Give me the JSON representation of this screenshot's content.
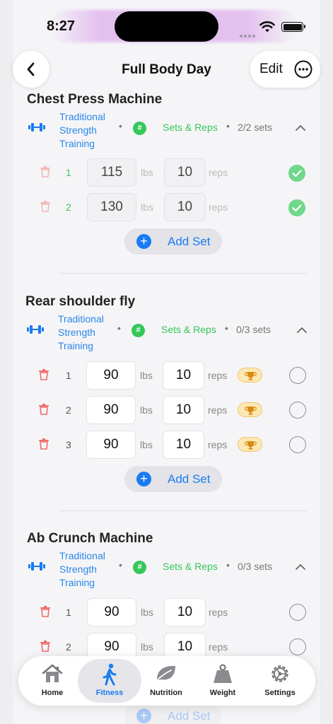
{
  "status": {
    "time": "8:27"
  },
  "header": {
    "title": "Full Body Day",
    "edit_label": "Edit"
  },
  "exercises": [
    {
      "name": "Chest Press Machine",
      "type": "Traditional Strength Training",
      "type_lines": [
        "Traditional",
        "Strength",
        "Training"
      ],
      "mode": "Sets & Reps",
      "count": "2/2 sets",
      "sets": [
        {
          "num": "1",
          "weight": "115",
          "unit": "lbs",
          "reps": "10",
          "reps_unit": "reps",
          "done": true
        },
        {
          "num": "2",
          "weight": "130",
          "unit": "lbs",
          "reps": "10",
          "reps_unit": "reps",
          "done": true
        }
      ],
      "add_label": "Add Set"
    },
    {
      "name": "Rear shoulder fly",
      "type": "Traditional Strength Training",
      "type_lines": [
        "Traditional",
        "Strength",
        "Training"
      ],
      "mode": "Sets & Reps",
      "count": "0/3 sets",
      "sets": [
        {
          "num": "1",
          "weight": "90",
          "unit": "lbs",
          "reps": "10",
          "reps_unit": "reps",
          "done": false
        },
        {
          "num": "2",
          "weight": "90",
          "unit": "lbs",
          "reps": "10",
          "reps_unit": "reps",
          "done": false
        },
        {
          "num": "3",
          "weight": "90",
          "unit": "lbs",
          "reps": "10",
          "reps_unit": "reps",
          "done": false
        }
      ],
      "add_label": "Add Set"
    },
    {
      "name": "Ab Crunch Machine",
      "type": "Traditional Strength Training",
      "type_lines": [
        "Traditional",
        "Strength",
        "Training"
      ],
      "mode": "Sets & Reps",
      "count": "0/3 sets",
      "sets": [
        {
          "num": "1",
          "weight": "90",
          "unit": "lbs",
          "reps": "10",
          "reps_unit": "reps",
          "done": false
        },
        {
          "num": "2",
          "weight": "90",
          "unit": "lbs",
          "reps": "10",
          "reps_unit": "reps",
          "done": false
        }
      ],
      "add_label": "Add Set"
    }
  ],
  "tabs": [
    {
      "label": "Home",
      "icon": "home-icon"
    },
    {
      "label": "Fitness",
      "icon": "figure-walk-icon",
      "active": true
    },
    {
      "label": "Nutrition",
      "icon": "leaf-icon"
    },
    {
      "label": "Weight",
      "icon": "scale-weight-icon"
    },
    {
      "label": "Settings",
      "icon": "gear-icon"
    }
  ],
  "colors": {
    "accent": "#1a7bf2",
    "green": "#35c759",
    "type_blue": "#2a86e8",
    "trash_red": "#ef6b6b",
    "trophy_bg": "#fde7b4"
  }
}
